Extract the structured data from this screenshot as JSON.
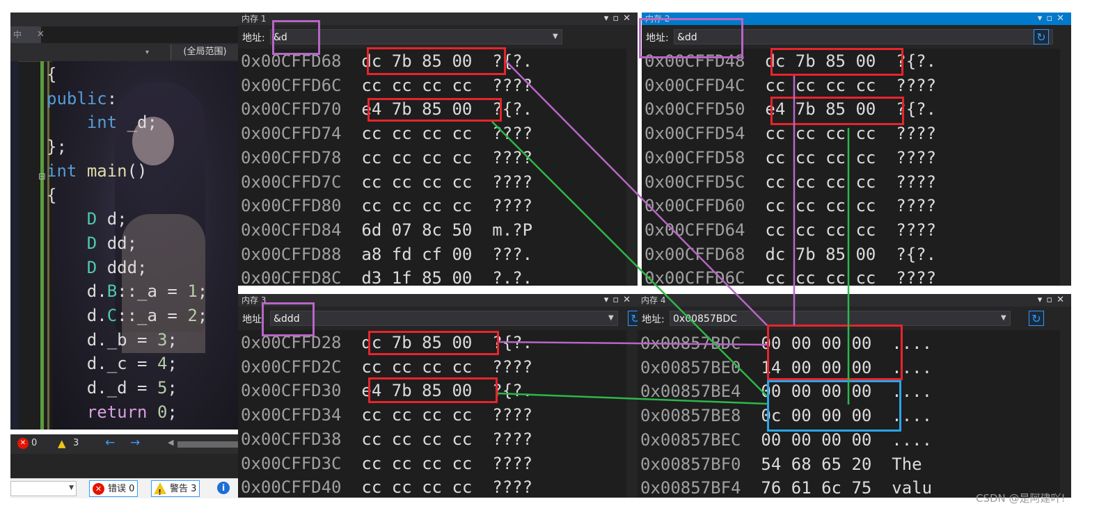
{
  "editor": {
    "scope_label": "(全局范围)",
    "code_lines": [
      "{",
      "public:",
      "    int _d;",
      "};",
      "int main()",
      "{",
      "    D d;",
      "    D dd;",
      "    D ddd;",
      "    d.B::_a = 1;",
      "    d.C::_a = 2;",
      "    d._b = 3;",
      "    d._c = 4;",
      "    d._d = 5;",
      "    return 0;"
    ],
    "status": {
      "errors": "0",
      "warnings": "3"
    }
  },
  "error_list": {
    "errors_label": "错误 0",
    "warnings_label": "警告 3"
  },
  "memory_windows": [
    {
      "title": "内存 1",
      "address_label": "地址:",
      "address": "&d",
      "rows": [
        {
          "addr": "0x00CFFD68",
          "bytes": "dc 7b 85 00",
          "ascii": "?{?."
        },
        {
          "addr": "0x00CFFD6C",
          "bytes": "cc cc cc cc",
          "ascii": "????"
        },
        {
          "addr": "0x00CFFD70",
          "bytes": "e4 7b 85 00",
          "ascii": "?{?."
        },
        {
          "addr": "0x00CFFD74",
          "bytes": "cc cc cc cc",
          "ascii": "????"
        },
        {
          "addr": "0x00CFFD78",
          "bytes": "cc cc cc cc",
          "ascii": "????"
        },
        {
          "addr": "0x00CFFD7C",
          "bytes": "cc cc cc cc",
          "ascii": "????"
        },
        {
          "addr": "0x00CFFD80",
          "bytes": "cc cc cc cc",
          "ascii": "????"
        },
        {
          "addr": "0x00CFFD84",
          "bytes": "6d 07 8c 50",
          "ascii": "m.?P"
        },
        {
          "addr": "0x00CFFD88",
          "bytes": "a8 fd cf 00",
          "ascii": "???."
        },
        {
          "addr": "0x00CFFD8C",
          "bytes": "d3 1f 85 00",
          "ascii": "?.?."
        }
      ]
    },
    {
      "title": "内存 2",
      "address_label": "地址:",
      "address": "&dd",
      "rows": [
        {
          "addr": "0x00CFFD48",
          "bytes": "dc 7b 85 00",
          "ascii": "?{?."
        },
        {
          "addr": "0x00CFFD4C",
          "bytes": "cc cc cc cc",
          "ascii": "????"
        },
        {
          "addr": "0x00CFFD50",
          "bytes": "e4 7b 85 00",
          "ascii": "?{?."
        },
        {
          "addr": "0x00CFFD54",
          "bytes": "cc cc cc cc",
          "ascii": "????"
        },
        {
          "addr": "0x00CFFD58",
          "bytes": "cc cc cc cc",
          "ascii": "????"
        },
        {
          "addr": "0x00CFFD5C",
          "bytes": "cc cc cc cc",
          "ascii": "????"
        },
        {
          "addr": "0x00CFFD60",
          "bytes": "cc cc cc cc",
          "ascii": "????"
        },
        {
          "addr": "0x00CFFD64",
          "bytes": "cc cc cc cc",
          "ascii": "????"
        },
        {
          "addr": "0x00CFFD68",
          "bytes": "dc 7b 85 00",
          "ascii": "?{?."
        },
        {
          "addr": "0x00CFFD6C",
          "bytes": "cc cc cc cc",
          "ascii": "????"
        }
      ]
    },
    {
      "title": "内存 3",
      "address_label": "地址:",
      "address": "&ddd",
      "rows": [
        {
          "addr": "0x00CFFD28",
          "bytes": "dc 7b 85 00",
          "ascii": "?{?."
        },
        {
          "addr": "0x00CFFD2C",
          "bytes": "cc cc cc cc",
          "ascii": "????"
        },
        {
          "addr": "0x00CFFD30",
          "bytes": "e4 7b 85 00",
          "ascii": "?{?."
        },
        {
          "addr": "0x00CFFD34",
          "bytes": "cc cc cc cc",
          "ascii": "????"
        },
        {
          "addr": "0x00CFFD38",
          "bytes": "cc cc cc cc",
          "ascii": "????"
        },
        {
          "addr": "0x00CFFD3C",
          "bytes": "cc cc cc cc",
          "ascii": "????"
        },
        {
          "addr": "0x00CFFD40",
          "bytes": "cc cc cc cc",
          "ascii": "????"
        }
      ]
    },
    {
      "title": "内存 4",
      "address_label": "地址:",
      "address": "0x00857BDC",
      "rows": [
        {
          "addr": "0x00857BDC",
          "bytes": "00 00 00 00",
          "ascii": "...."
        },
        {
          "addr": "0x00857BE0",
          "bytes": "14 00 00 00",
          "ascii": "...."
        },
        {
          "addr": "0x00857BE4",
          "bytes": "00 00 00 00",
          "ascii": "...."
        },
        {
          "addr": "0x00857BE8",
          "bytes": "0c 00 00 00",
          "ascii": "...."
        },
        {
          "addr": "0x00857BEC",
          "bytes": "00 00 00 00",
          "ascii": "...."
        },
        {
          "addr": "0x00857BF0",
          "bytes": "54 68 65 20",
          "ascii": "The "
        },
        {
          "addr": "0x00857BF4",
          "bytes": "76 61 6c 75",
          "ascii": "valu"
        }
      ]
    }
  ],
  "annotation_colors": {
    "red": "#e8242c",
    "purple": "#b766c6",
    "blue": "#2aa5e8",
    "green": "#2db84a"
  },
  "watermark": "CSDN @是阿建吖!"
}
